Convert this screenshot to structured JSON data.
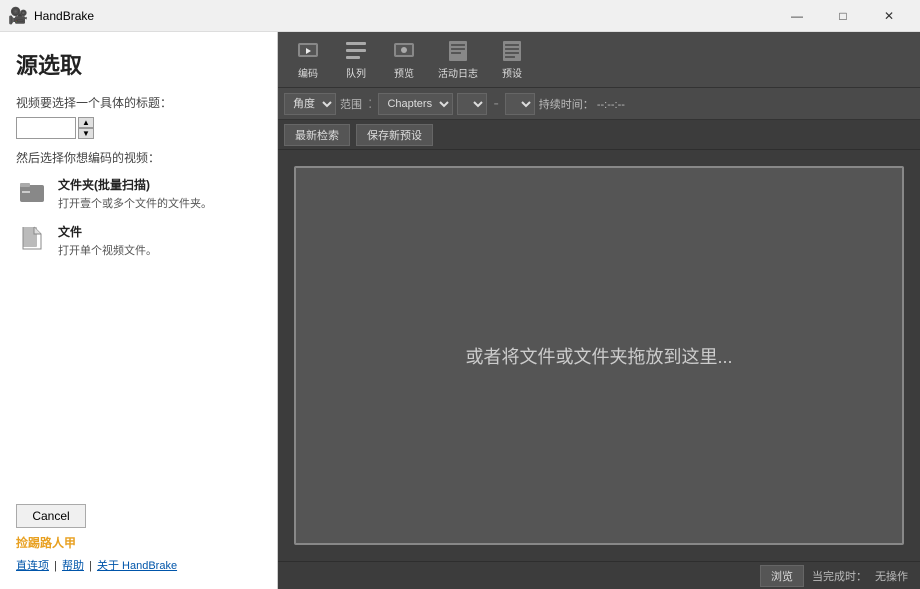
{
  "titlebar": {
    "icon": "🎬",
    "title": "HandBrake",
    "minimize_label": "—",
    "maximize_label": "□",
    "close_label": "✕"
  },
  "left_panel": {
    "title": "源选取",
    "subtitle": "视频要选择一个具体的标题：",
    "then_label": "然后选择你想编码的视频：",
    "folder_option": {
      "title": "文件夹(批量扫描)",
      "desc": "打开壹个或多个文件的文件夹。"
    },
    "file_option": {
      "title": "文件",
      "desc": "打开单个视频文件。"
    },
    "cancel_label": "Cancel",
    "watermark": "捡踢路人甲",
    "links": {
      "settings": "直连项",
      "help": "帮助",
      "about": "关于 HandBrake",
      "separator1": "|",
      "separator2": "|"
    }
  },
  "toolbar": {
    "buttons": [
      {
        "icon": "🖼️",
        "label": "编码"
      },
      {
        "icon": "🖼️",
        "label": "队列"
      },
      {
        "icon": "🖼️",
        "label": "预览"
      },
      {
        "icon": "📋",
        "label": "活动日志"
      },
      {
        "icon": "📋",
        "label": "预设"
      }
    ]
  },
  "controls_bar": {
    "angle_label": "角度",
    "range_label": "范围",
    "chapters_label": "Chapters",
    "duration_prefix": "持续时间：",
    "duration_value": "--:--:--"
  },
  "action_bar": {
    "update_btn": "最新检索",
    "save_btn": "保存新预设"
  },
  "drop_zone": {
    "text": "或者将文件或文件夹拖放到这里..."
  },
  "status_bar": {
    "status_label": "当完成时：",
    "status_value": "无操作",
    "browse_label": "浏览"
  }
}
